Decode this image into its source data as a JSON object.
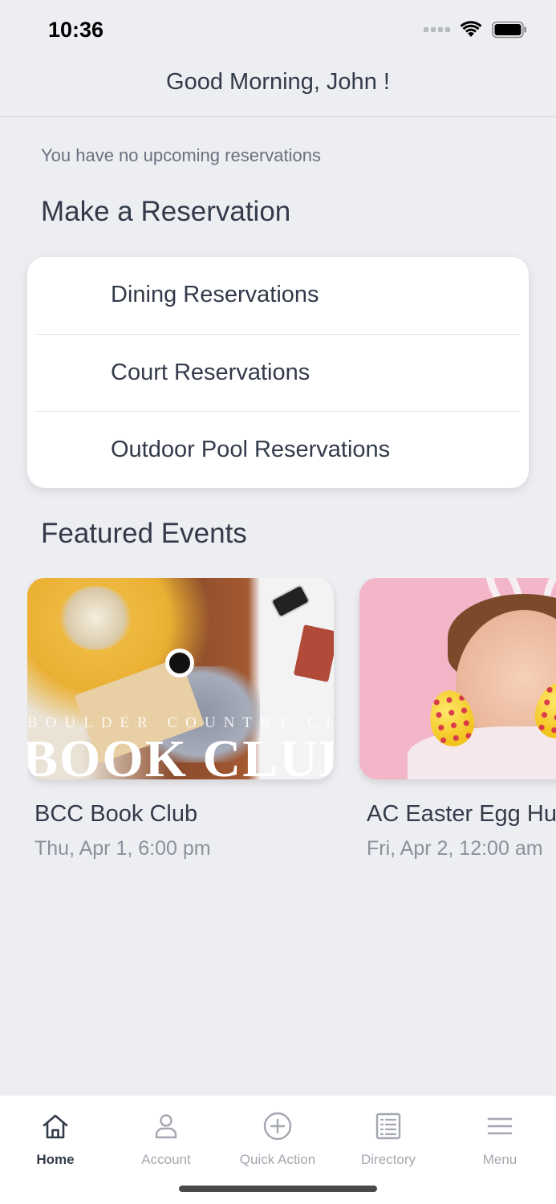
{
  "status_bar": {
    "time": "10:36"
  },
  "header": {
    "greeting": "Good Morning, John !"
  },
  "reservations": {
    "empty_message": "You have no upcoming reservations",
    "section_title": "Make a Reservation",
    "items": [
      {
        "label": "Dining Reservations"
      },
      {
        "label": "Court Reservations"
      },
      {
        "label": "Outdoor Pool Reservations"
      }
    ]
  },
  "events": {
    "section_title": "Featured Events",
    "items": [
      {
        "title": "BCC Book Club",
        "date": "Thu, Apr 1, 6:00 pm",
        "image_subtitle": "BOULDER COUNTRY CLUB",
        "image_title": "BOOK CLUB"
      },
      {
        "title": "AC Easter Egg Hunt",
        "date": "Fri, Apr 2, 12:00 am"
      }
    ]
  },
  "tab_bar": {
    "tabs": [
      {
        "label": "Home",
        "icon": "home-icon",
        "active": true
      },
      {
        "label": "Account",
        "icon": "person-icon",
        "active": false
      },
      {
        "label": "Quick Action",
        "icon": "plus-circle-icon",
        "active": false
      },
      {
        "label": "Directory",
        "icon": "list-document-icon",
        "active": false
      },
      {
        "label": "Menu",
        "icon": "hamburger-icon",
        "active": false
      }
    ]
  },
  "colors": {
    "background": "#edeef2",
    "text_primary": "#333a4a",
    "text_secondary": "#8c909b",
    "tab_inactive": "#a3a7b0"
  }
}
